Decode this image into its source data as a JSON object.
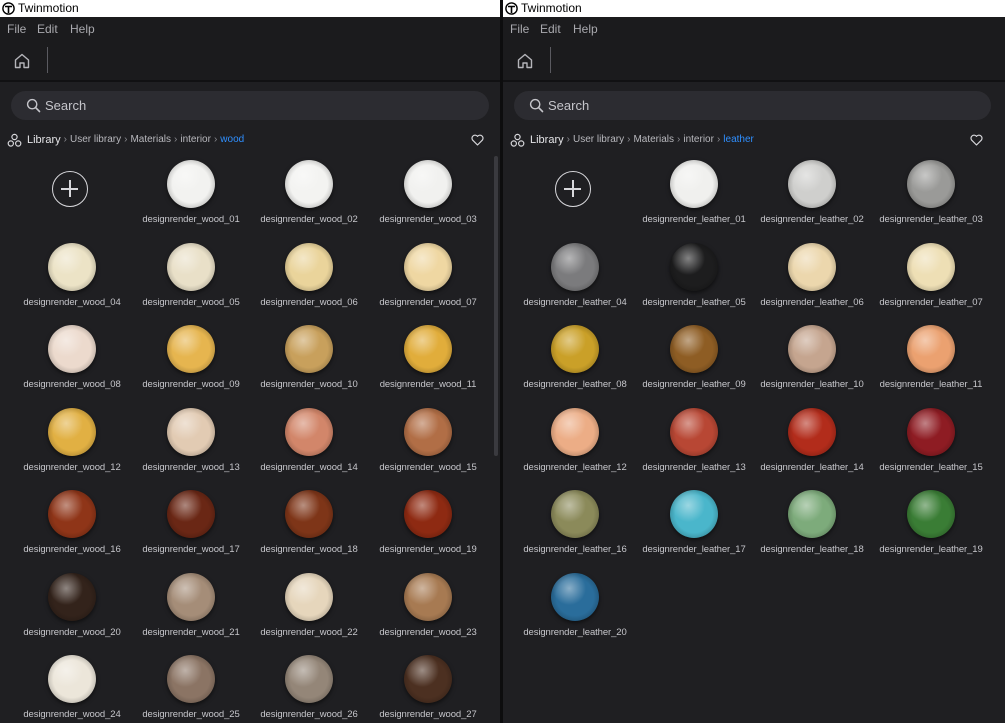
{
  "panes": [
    {
      "window": {
        "title": "Twinmotion",
        "logo_icon": "twinmotion-logo-icon"
      },
      "menu": [
        "File",
        "Edit",
        "Help"
      ],
      "search": {
        "placeholder": "Search"
      },
      "breadcrumb": {
        "root": "Library",
        "path": [
          "User library",
          "Materials",
          "interior"
        ],
        "active": "wood"
      },
      "items": [
        {
          "label": "designrender_wood_01",
          "color": "#f2f2f0"
        },
        {
          "label": "designrender_wood_02",
          "color": "#f3f3f1"
        },
        {
          "label": "designrender_wood_03",
          "color": "#f1f1ef"
        },
        {
          "label": "designrender_wood_04",
          "color": "#ece3c6"
        },
        {
          "label": "designrender_wood_05",
          "color": "#e9e0c8"
        },
        {
          "label": "designrender_wood_06",
          "color": "#ead49b"
        },
        {
          "label": "designrender_wood_07",
          "color": "#efd7a2"
        },
        {
          "label": "designrender_wood_08",
          "color": "#ecdacd"
        },
        {
          "label": "designrender_wood_09",
          "color": "#e6b54f"
        },
        {
          "label": "designrender_wood_10",
          "color": "#c8a05c"
        },
        {
          "label": "designrender_wood_11",
          "color": "#e1ad3b"
        },
        {
          "label": "designrender_wood_12",
          "color": "#e1b043"
        },
        {
          "label": "designrender_wood_13",
          "color": "#e2cbb3"
        },
        {
          "label": "designrender_wood_14",
          "color": "#d2866a"
        },
        {
          "label": "designrender_wood_15",
          "color": "#b16e46"
        },
        {
          "label": "designrender_wood_16",
          "color": "#8f3518"
        },
        {
          "label": "designrender_wood_17",
          "color": "#6a2715"
        },
        {
          "label": "designrender_wood_18",
          "color": "#7e3518"
        },
        {
          "label": "designrender_wood_19",
          "color": "#8e2a12"
        },
        {
          "label": "designrender_wood_20",
          "color": "#33231b"
        },
        {
          "label": "designrender_wood_21",
          "color": "#a58d78"
        },
        {
          "label": "designrender_wood_22",
          "color": "#e6d6bc"
        },
        {
          "label": "designrender_wood_23",
          "color": "#a77a52"
        },
        {
          "label": "designrender_wood_24",
          "color": "#ece6da"
        },
        {
          "label": "designrender_wood_25",
          "color": "#8b7464"
        },
        {
          "label": "designrender_wood_26",
          "color": "#948678"
        },
        {
          "label": "designrender_wood_27",
          "color": "#4c3021"
        }
      ]
    },
    {
      "window": {
        "title": "Twinmotion",
        "logo_icon": "twinmotion-logo-icon"
      },
      "menu": [
        "File",
        "Edit",
        "Help"
      ],
      "search": {
        "placeholder": "Search"
      },
      "breadcrumb": {
        "root": "Library",
        "path": [
          "User library",
          "Materials",
          "interior"
        ],
        "active": "leather"
      },
      "items": [
        {
          "label": "designrender_leather_01",
          "color": "#f0f0ee"
        },
        {
          "label": "designrender_leather_02",
          "color": "#cfcfcd"
        },
        {
          "label": "designrender_leather_03",
          "color": "#9a9a98"
        },
        {
          "label": "designrender_leather_04",
          "color": "#7b7b7d"
        },
        {
          "label": "designrender_leather_05",
          "color": "#1d1d1e"
        },
        {
          "label": "designrender_leather_06",
          "color": "#ecd7ad"
        },
        {
          "label": "designrender_leather_07",
          "color": "#eedfb5"
        },
        {
          "label": "designrender_leather_08",
          "color": "#caa028"
        },
        {
          "label": "designrender_leather_09",
          "color": "#8e5d24"
        },
        {
          "label": "designrender_leather_10",
          "color": "#c5a58f"
        },
        {
          "label": "designrender_leather_11",
          "color": "#eba170"
        },
        {
          "label": "designrender_leather_12",
          "color": "#ecad86"
        },
        {
          "label": "designrender_leather_13",
          "color": "#b84734"
        },
        {
          "label": "designrender_leather_14",
          "color": "#b22c1b"
        },
        {
          "label": "designrender_leather_15",
          "color": "#8e1c23"
        },
        {
          "label": "designrender_leather_16",
          "color": "#8b8a5a"
        },
        {
          "label": "designrender_leather_17",
          "color": "#4ab6cb"
        },
        {
          "label": "designrender_leather_18",
          "color": "#7dab7b"
        },
        {
          "label": "designrender_leather_19",
          "color": "#3a7d35"
        },
        {
          "label": "designrender_leather_20",
          "color": "#2a6d9b"
        }
      ]
    }
  ]
}
